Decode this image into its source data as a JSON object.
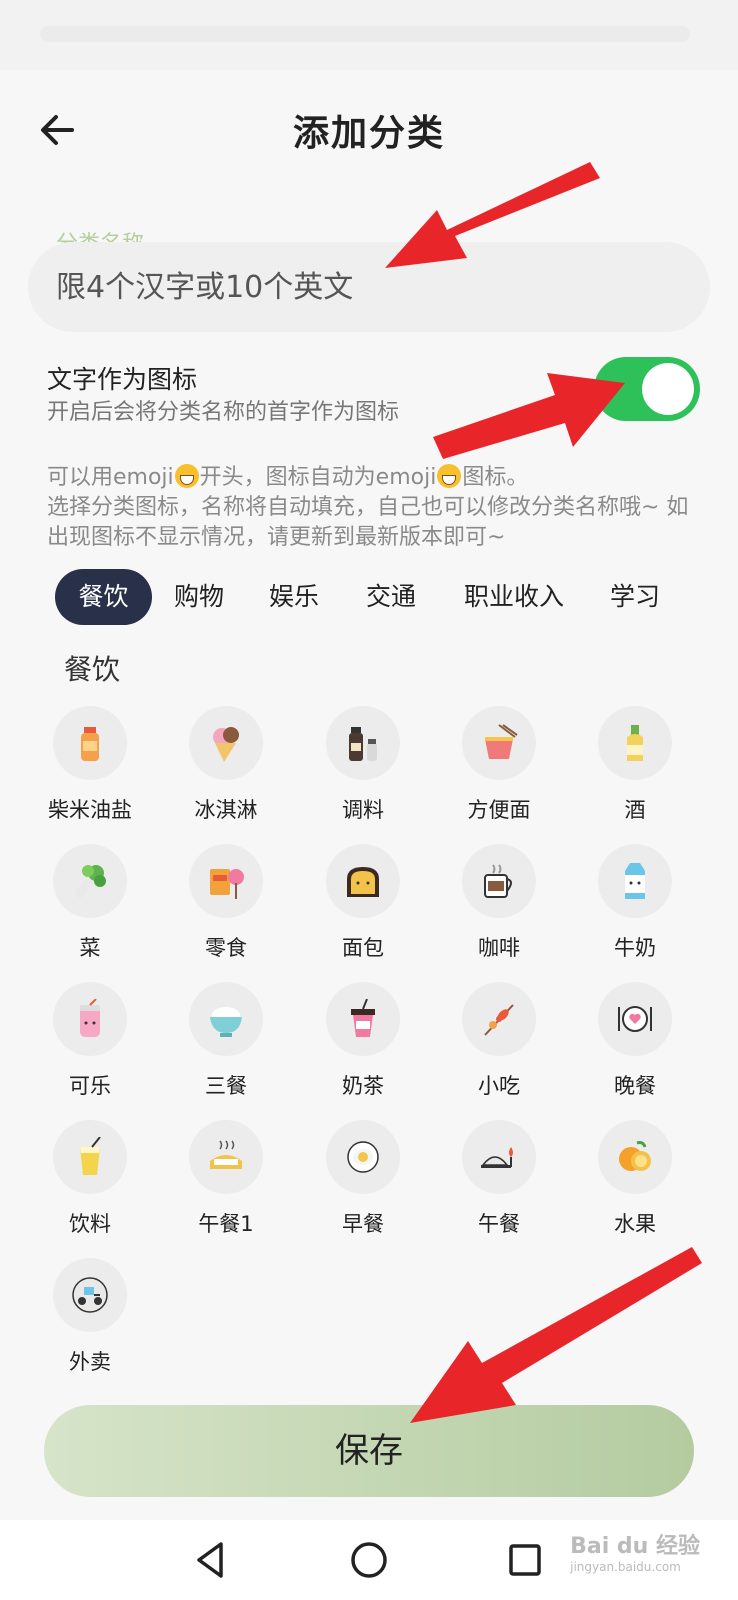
{
  "header": {
    "title": "添加分类"
  },
  "name_field": {
    "label": "分类名称",
    "placeholder": "限4个汉字或10个英文"
  },
  "text_icon_option": {
    "title": "文字作为图标",
    "subtitle": "开启后会将分类名称的首字作为图标",
    "enabled": true
  },
  "hint": {
    "part1": "可以用emoji",
    "part2": "开头，图标自动为emoji",
    "part3": "图标。",
    "line2": "选择分类图标，名称将自动填充，自己也可以修改分类名称哦~ 如出现图标不显示情况，请更新到最新版本即可~"
  },
  "tabs": [
    "餐饮",
    "购物",
    "娱乐",
    "交通",
    "职业收入",
    "学习"
  ],
  "active_tab": "餐饮",
  "section_title": "餐饮",
  "icons": [
    {
      "label": "柴米油盐",
      "icon": "oil-bottle-icon"
    },
    {
      "label": "冰淇淋",
      "icon": "ice-cream-icon"
    },
    {
      "label": "调料",
      "icon": "seasoning-icon"
    },
    {
      "label": "方便面",
      "icon": "instant-noodle-icon"
    },
    {
      "label": "酒",
      "icon": "wine-bottle-icon"
    },
    {
      "label": "菜",
      "icon": "vegetable-icon"
    },
    {
      "label": "零食",
      "icon": "snack-icon"
    },
    {
      "label": "面包",
      "icon": "bread-icon"
    },
    {
      "label": "咖啡",
      "icon": "coffee-icon"
    },
    {
      "label": "牛奶",
      "icon": "milk-icon"
    },
    {
      "label": "可乐",
      "icon": "cola-icon"
    },
    {
      "label": "三餐",
      "icon": "rice-bowl-icon"
    },
    {
      "label": "奶茶",
      "icon": "milk-tea-icon"
    },
    {
      "label": "小吃",
      "icon": "skewer-icon"
    },
    {
      "label": "晚餐",
      "icon": "dinner-plate-icon"
    },
    {
      "label": "饮料",
      "icon": "juice-icon"
    },
    {
      "label": "午餐1",
      "icon": "lunch-box-icon"
    },
    {
      "label": "早餐",
      "icon": "fried-egg-icon"
    },
    {
      "label": "午餐",
      "icon": "lunch-tray-icon"
    },
    {
      "label": "水果",
      "icon": "orange-icon"
    },
    {
      "label": "外卖",
      "icon": "delivery-scooter-icon"
    }
  ],
  "save_label": "保存",
  "watermark": {
    "brand": "Bai du 经验",
    "site": "jingyan.baidu.com"
  },
  "colors": {
    "toggle_on": "#2fc159",
    "tab_active": "#28304a",
    "field_label": "#b6cf9d",
    "annotation_arrow": "#e8262a"
  }
}
